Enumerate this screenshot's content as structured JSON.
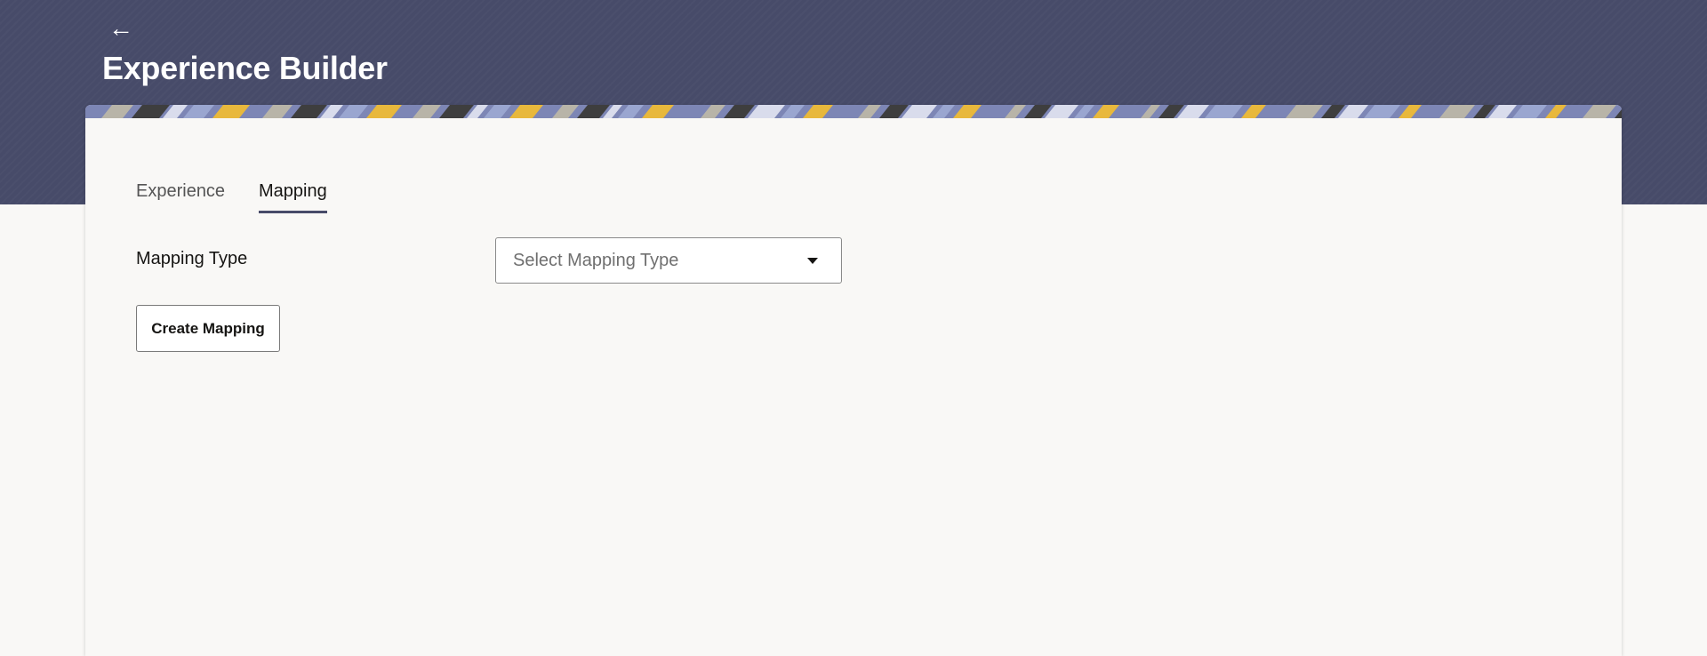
{
  "header": {
    "back_icon": "arrow-left-icon",
    "back_glyph": "←",
    "title": "Experience Builder"
  },
  "tabs": [
    {
      "label": "Experience",
      "active": false
    },
    {
      "label": "Mapping",
      "active": true
    }
  ],
  "form": {
    "mapping_type_label": "Mapping Type",
    "mapping_type_placeholder": "Select Mapping Type",
    "dropdown_icon": "caret-down-icon"
  },
  "actions": {
    "create_mapping_label": "Create Mapping"
  },
  "colors": {
    "header_bg": "#474b69",
    "page_bg": "#f9f8f6",
    "active_tab_underline": "#474b69",
    "banner_stripes": [
      "#e8b83c",
      "#9aa6d0",
      "#d9dcec",
      "#3e3e3e",
      "#b8b4a8",
      "#7d86b5"
    ]
  }
}
